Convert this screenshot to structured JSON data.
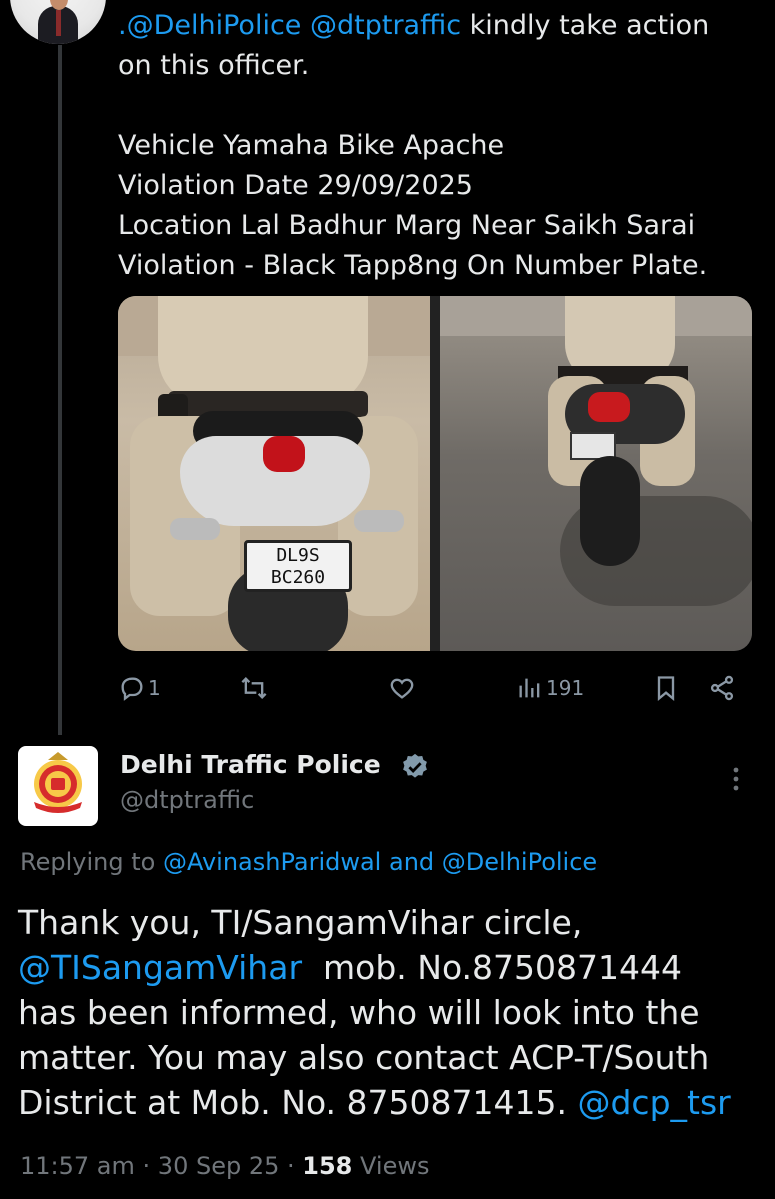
{
  "tweet1": {
    "line1_mention1": ".@DelhiPolice",
    "line1_mention2": "@dtptraffic",
    "line1_rest": "kindly take action",
    "line2": "on this officer.",
    "line3": "Vehicle Yamaha Bike Apache",
    "line4": "Violation Date 29/09/2025",
    "line5": "Location Lal Badhur Marg Near Saikh Sarai",
    "line6": "Violation - Black Tapp8ng On Number Plate.",
    "plate_top": "DL9S",
    "plate_bottom": "BC260",
    "actions": {
      "reply_count": "1",
      "retweet_count": "",
      "like_count": "",
      "views_count": "191"
    },
    "icons": [
      "reply-icon",
      "retweet-icon",
      "like-icon",
      "views-icon",
      "bookmark-icon",
      "share-icon"
    ]
  },
  "tweet2": {
    "display_name": "Delhi Traffic Police",
    "handle": "@dtptraffic",
    "replying_prefix": "Replying to",
    "replying_user1": "@AvinashParidwal",
    "replying_and": "and",
    "replying_user2": "@DelhiPolice",
    "text_line1": "Thank you, TI/SangamVihar circle,",
    "text_line2_mention": "@TISangamVihar",
    "text_line2_rest": "mob. No.8750871444",
    "text_line3": "has been informed, who will look into the",
    "text_line4": "matter. You may also contact ACP-T/South",
    "text_line5": "District at Mob. No. 8750871415.",
    "text_line5_mention": "@dcp_tsr",
    "time": "11:57 am",
    "date": "30 Sep 25",
    "views_count": "158",
    "views_label": "Views"
  },
  "colors": {
    "background": "#000000",
    "text": "#e7e9ea",
    "muted": "#71767b",
    "link": "#1d9bf0"
  }
}
